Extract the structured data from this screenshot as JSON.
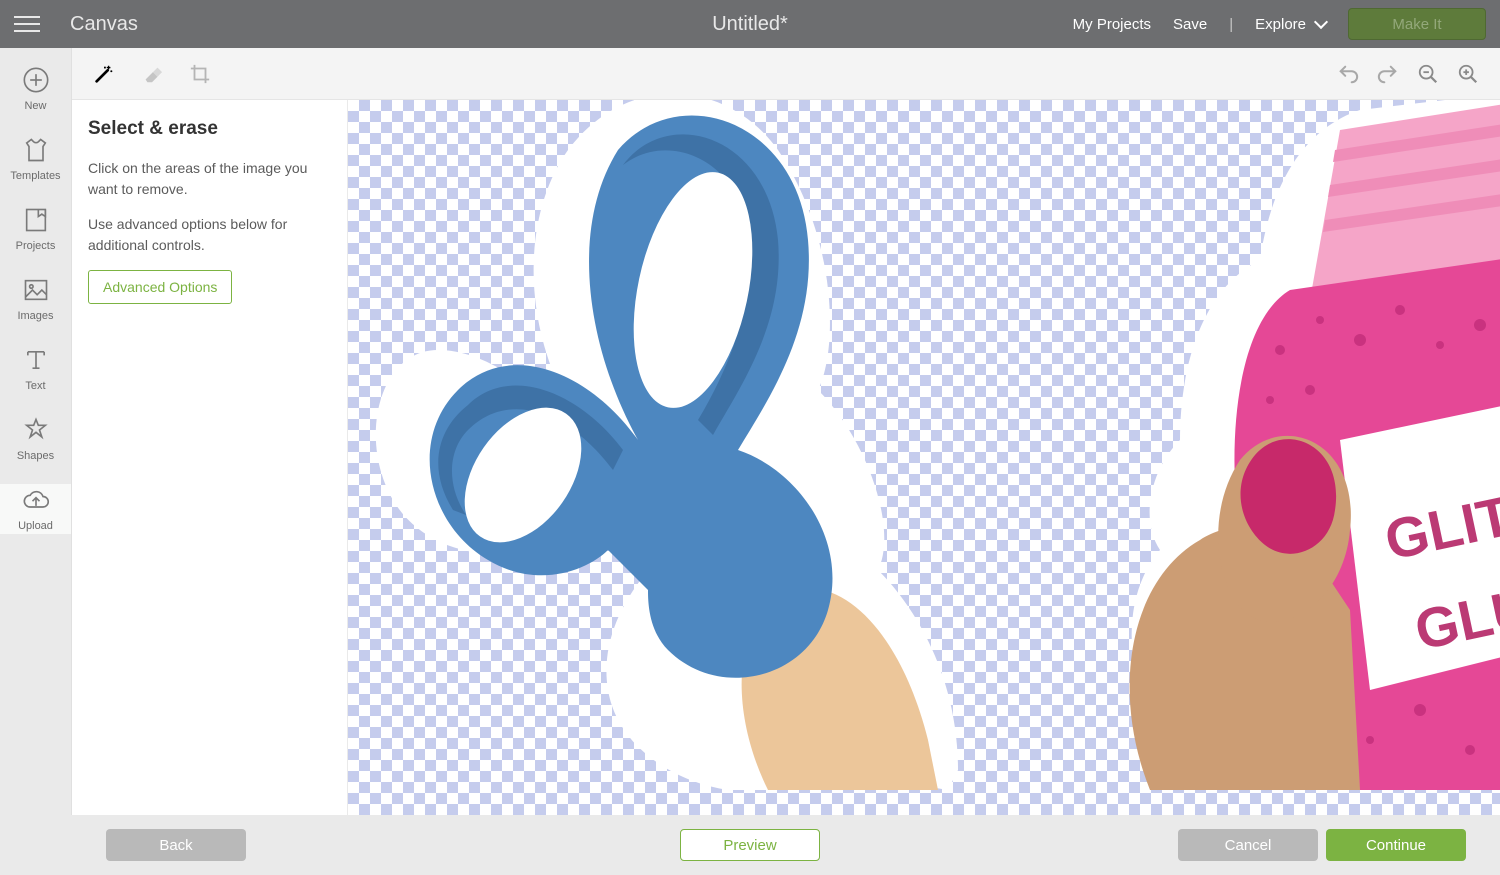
{
  "header": {
    "app_name": "Canvas",
    "document_title": "Untitled*",
    "my_projects": "My Projects",
    "save": "Save",
    "explore": "Explore",
    "make_it": "Make It"
  },
  "left_nav": {
    "new": "New",
    "templates": "Templates",
    "projects": "Projects",
    "images": "Images",
    "text": "Text",
    "shapes": "Shapes",
    "upload": "Upload"
  },
  "toolbar": {
    "tools": [
      "wand-icon",
      "eraser-icon",
      "crop-icon"
    ],
    "history": [
      "undo-icon",
      "redo-icon",
      "zoom-out-icon",
      "zoom-in-icon"
    ]
  },
  "panel": {
    "title": "Select & erase",
    "para1": "Click on the areas of the image you want to remove.",
    "para2": "Use advanced options below for additional controls.",
    "advanced_button": "Advanced Options"
  },
  "canvas": {
    "image_description": "Illustration on transparent checkerboard showing blue scissors with beige handle (left) and a hand with pink nail holding a pink glitter glue bottle with text 'GLITTER GLUE' (right). White outline sticker border around shapes.",
    "glitter_text_line1": "GLITTER",
    "glitter_text_line2": "GLUE",
    "colors": {
      "scissors_blue": "#4d87c0",
      "scissors_dark": "#3e72a6",
      "handle": "#ecc69a",
      "skin": "#cc9d74",
      "nail": "#c7296a",
      "glitter_pink": "#e54896",
      "glitter_dark": "#c9327f",
      "label_pink": "#bb3a74",
      "white": "#ffffff"
    }
  },
  "footer": {
    "back": "Back",
    "preview": "Preview",
    "cancel": "Cancel",
    "continue": "Continue"
  }
}
